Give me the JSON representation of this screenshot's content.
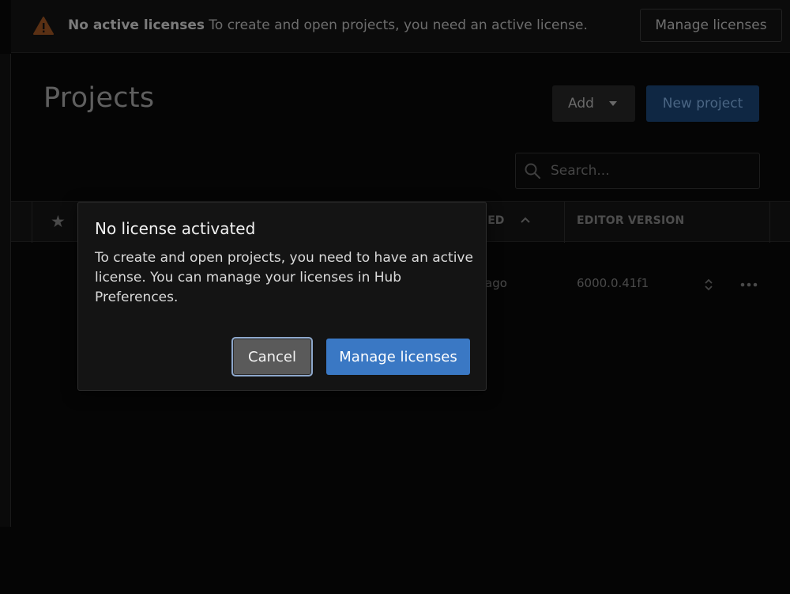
{
  "banner": {
    "title": "No active licenses",
    "message": "To create and open projects, you need an active license.",
    "button": "Manage licenses",
    "icon": "warning-icon"
  },
  "page": {
    "title": "Projects",
    "add_label": "Add",
    "new_project_label": "New project",
    "search_placeholder": "Search..."
  },
  "table": {
    "columns": {
      "modified": "IED",
      "editor_version": "EDITOR VERSION"
    },
    "rows": [
      {
        "modified": "ago",
        "editor_version": "6000.0.41f1"
      }
    ]
  },
  "dialog": {
    "title": "No license activated",
    "body": "To create and open projects, you need to have an active license. You can manage your licenses in Hub Preferences.",
    "cancel_label": "Cancel",
    "confirm_label": "Manage licenses"
  },
  "colors": {
    "accent": "#3a78c4",
    "warning": "#b35a1f",
    "background": "#050505"
  }
}
